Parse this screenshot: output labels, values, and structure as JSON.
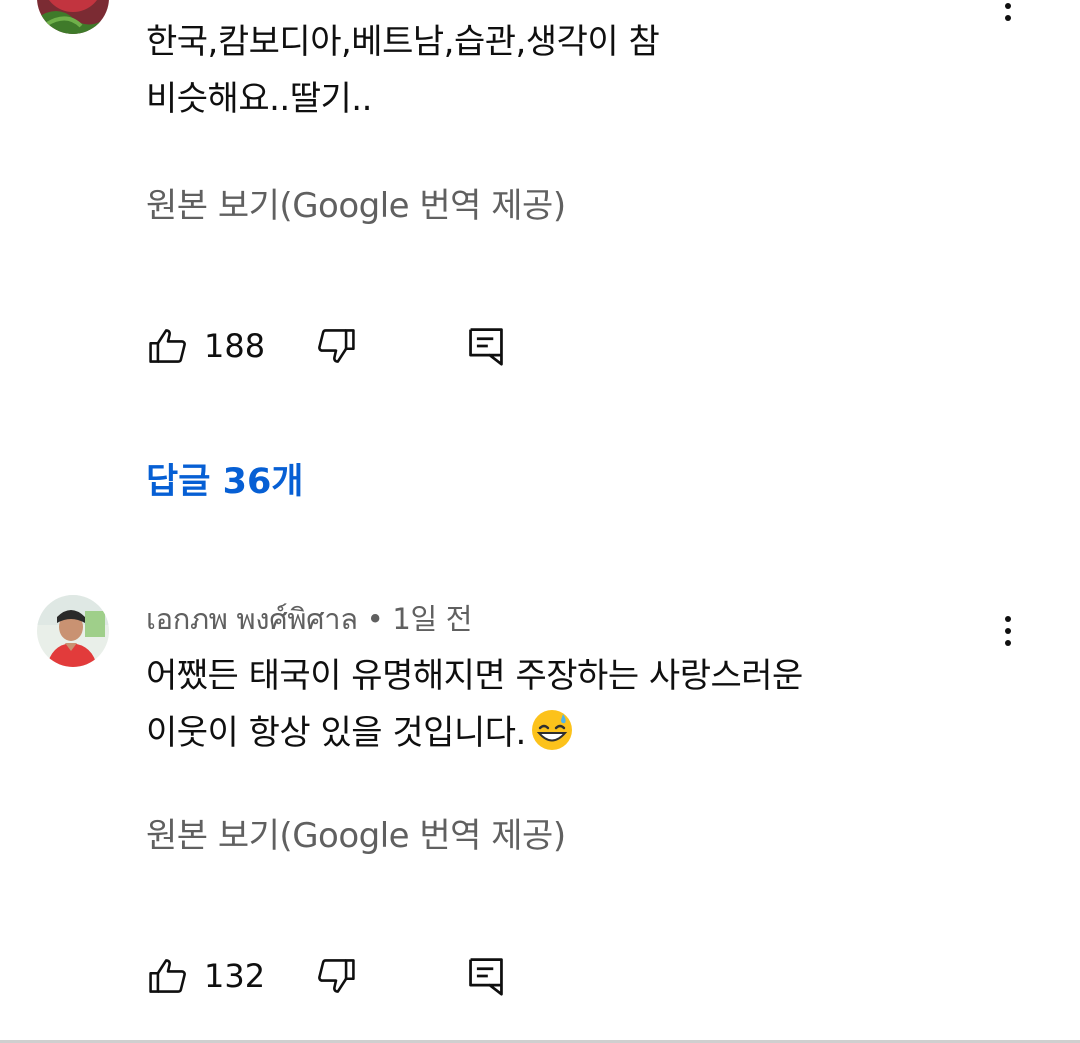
{
  "comments": [
    {
      "author": "",
      "time": "",
      "text_lines": [
        "한국,캄보디아,베트남,습관,생각이 참",
        "비슷해요..딸기.."
      ],
      "translate_label": "원본 보기(Google 번역 제공)",
      "likes": "188",
      "replies_label": "답글 36개"
    },
    {
      "author": "เอกภพ พงศ์พิศาล",
      "separator": "•",
      "time": "1일 전",
      "text_lines": [
        "어쨌든 태국이 유명해지면 주장하는 사랑스러운",
        "이웃이 항상 있을 것입니다."
      ],
      "emoji_icon": "grinning-face-with-sweat-icon",
      "translate_label": "원본 보기(Google 번역 제공)",
      "likes": "132"
    }
  ],
  "colors": {
    "text": "#0f0f0f",
    "secondary": "#606060",
    "link": "#065fd4"
  },
  "icons": [
    "like-icon",
    "dislike-icon",
    "reply-icon",
    "more-vert-icon",
    "avatar"
  ]
}
